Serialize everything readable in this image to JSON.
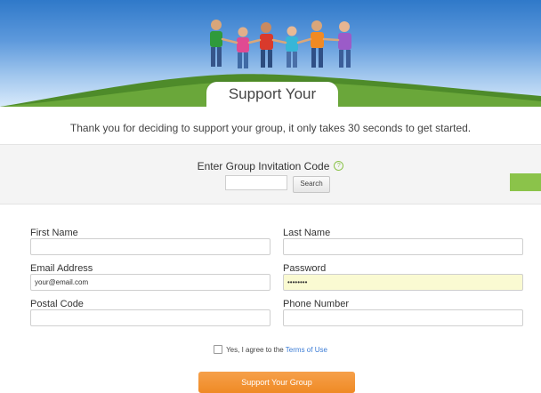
{
  "hero": {
    "title": "Support Your Group"
  },
  "intro": {
    "text": "Thank you for deciding to support your group, it only takes 30 seconds to get started."
  },
  "invitation": {
    "label": "Enter Group Invitation Code",
    "help_icon": "question-circle-icon",
    "code_value": "",
    "search_label": "Search"
  },
  "form": {
    "first_name": {
      "label": "First Name",
      "value": ""
    },
    "last_name": {
      "label": "Last Name",
      "value": ""
    },
    "email": {
      "label": "Email Address",
      "value": "your@email.com"
    },
    "password": {
      "label": "Password",
      "value": "••••••••"
    },
    "postal_code": {
      "label": "Postal Code",
      "value": ""
    },
    "phone": {
      "label": "Phone Number",
      "value": ""
    }
  },
  "agree": {
    "prefix": "Yes, I agree to the ",
    "link_text": "Terms of Use",
    "checked": false
  },
  "submit": {
    "label": "Support Your Group"
  },
  "colors": {
    "accent_orange": "#ef8a25",
    "accent_green": "#8bc34a",
    "link_blue": "#3a7bd5",
    "autofill_yellow": "#fafad2"
  }
}
